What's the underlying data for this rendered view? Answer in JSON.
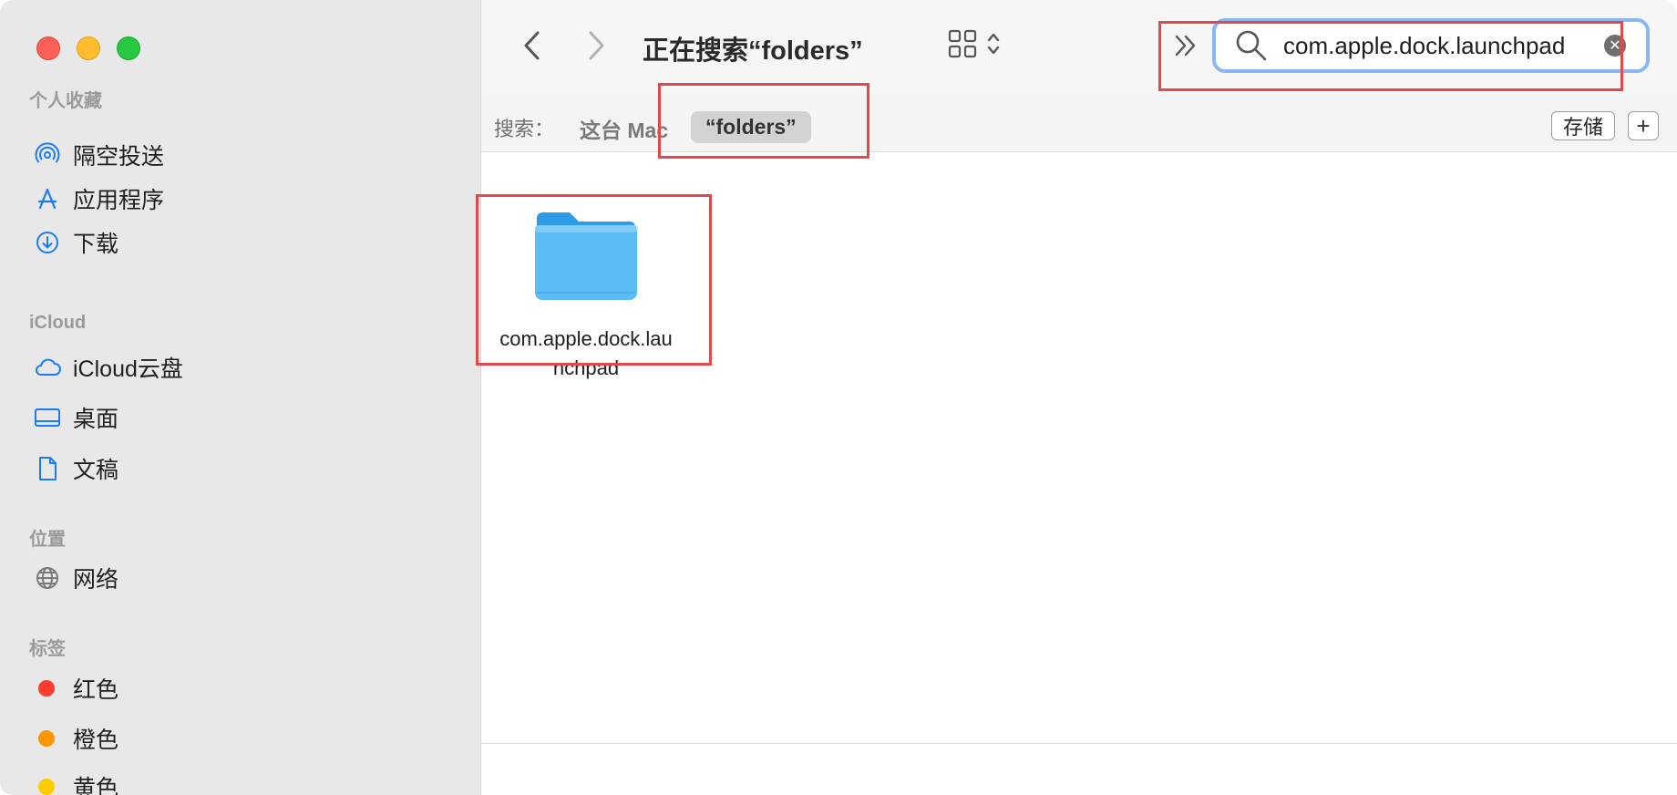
{
  "sidebar": {
    "sections": [
      {
        "title": "个人收藏"
      },
      {
        "title": "iCloud"
      },
      {
        "title": "位置"
      },
      {
        "title": "标签"
      }
    ],
    "favorites": [
      {
        "label": "隔空投送",
        "icon": "airdrop-icon"
      },
      {
        "label": "应用程序",
        "icon": "applications-icon"
      },
      {
        "label": "下载",
        "icon": "downloads-icon"
      }
    ],
    "icloud": [
      {
        "label": "iCloud云盘",
        "icon": "icloud-drive-icon"
      },
      {
        "label": "桌面",
        "icon": "desktop-icon"
      },
      {
        "label": "文稿",
        "icon": "document-icon"
      }
    ],
    "locations": [
      {
        "label": "网络",
        "icon": "network-icon"
      }
    ],
    "tags": [
      {
        "label": "红色",
        "color": "#ff3b30"
      },
      {
        "label": "橙色",
        "color": "#ff9500"
      },
      {
        "label": "黄色",
        "color": "#ffcc00"
      }
    ]
  },
  "toolbar": {
    "title": "正在搜索“folders”",
    "search_value": "com.apple.dock.launchpad"
  },
  "scope": {
    "label": "搜索：",
    "mac": "这台 Mac",
    "token": "“folders”",
    "save": "存储",
    "add": "+"
  },
  "results": [
    {
      "name": "com.apple.dock.launchpad",
      "icon": "folder-icon"
    }
  ],
  "colors": {
    "accent": "#1a7cf5",
    "highlight": "#e04a4a",
    "folder": "#5cbdf5"
  }
}
